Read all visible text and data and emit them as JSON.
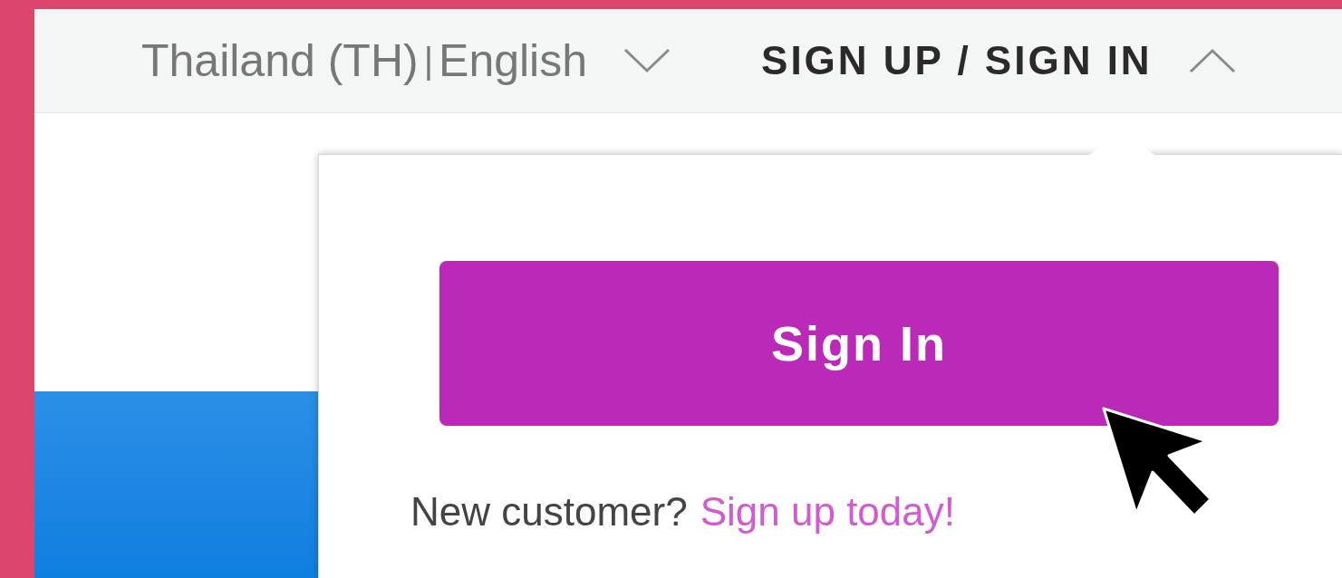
{
  "top_bar": {
    "region": "Thailand (TH)",
    "separator": "|",
    "language": "English",
    "account_label": "SIGN UP / SIGN IN",
    "account_menu_expanded": true
  },
  "account_menu": {
    "sign_in_button": "Sign In",
    "prompt": "New customer?",
    "signup_link": "Sign up today!"
  }
}
